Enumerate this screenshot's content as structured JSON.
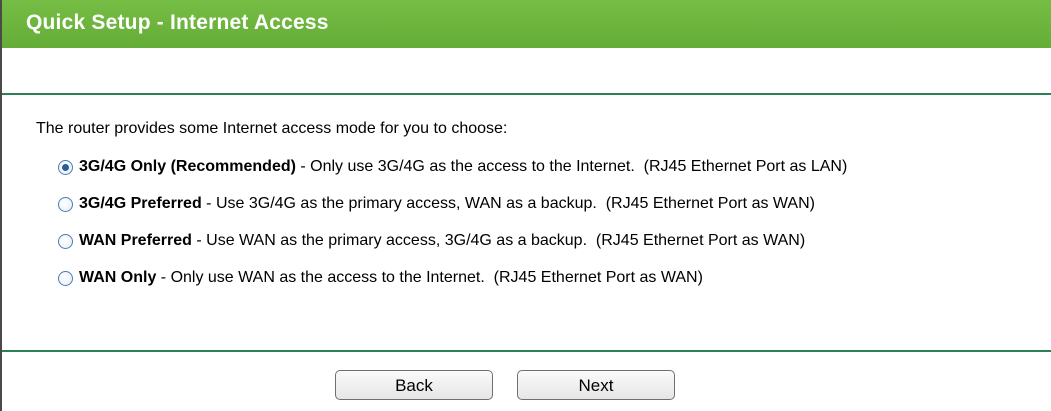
{
  "title": "Quick Setup - Internet Access",
  "intro": "The router provides some Internet access mode for you to choose:",
  "options": [
    {
      "name": "3G/4G Only (Recommended)",
      "desc": " - Only use 3G/4G as the access to the Internet.  (RJ45 Ethernet Port as LAN)",
      "checked": true
    },
    {
      "name": "3G/4G Preferred",
      "desc": " - Use 3G/4G as the primary access, WAN as a backup.  (RJ45 Ethernet Port as WAN)",
      "checked": false
    },
    {
      "name": "WAN Preferred",
      "desc": " - Use WAN as the primary access, 3G/4G as a backup.  (RJ45 Ethernet Port as WAN)",
      "checked": false
    },
    {
      "name": "WAN Only",
      "desc": " - Only use WAN as the access to the Internet.  (RJ45 Ethernet Port as WAN)",
      "checked": false
    }
  ],
  "buttons": {
    "back": "Back",
    "next": "Next"
  },
  "colors": {
    "title_bar": "#6cb33e",
    "rule": "#2f7f56",
    "radio_dot": "#2b5e96"
  }
}
